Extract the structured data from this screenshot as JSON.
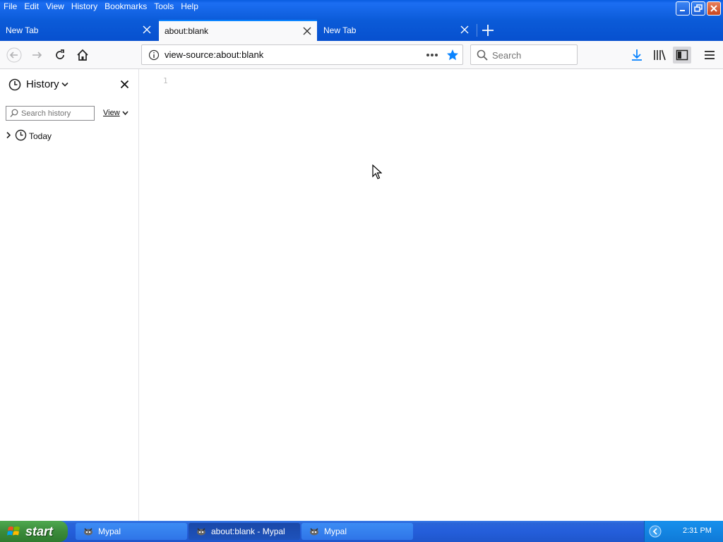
{
  "menu": {
    "items": [
      "File",
      "Edit",
      "View",
      "History",
      "Bookmarks",
      "Tools",
      "Help"
    ]
  },
  "tabs": [
    {
      "label": "New Tab",
      "active": false
    },
    {
      "label": "about:blank",
      "active": true
    },
    {
      "label": "New Tab",
      "active": false
    }
  ],
  "navbar": {
    "url": "view-source:about:blank",
    "search_placeholder": "Search"
  },
  "sidebar": {
    "title": "History",
    "search_placeholder": "Search history",
    "view_label": "View",
    "items": [
      {
        "label": "Today"
      }
    ]
  },
  "content": {
    "line_number": "1"
  },
  "taskbar": {
    "start_label": "start",
    "tasks": [
      {
        "label": "Mypal",
        "active": false
      },
      {
        "label": "about:blank - Mypal",
        "active": true
      },
      {
        "label": "Mypal",
        "active": false
      }
    ],
    "clock": "2:31 PM"
  },
  "colors": {
    "accent": "#0a84ff",
    "bookmark_star": "#0a84ff",
    "xp_blue": "#0b5bd8",
    "start_green": "#3b8b3b"
  }
}
